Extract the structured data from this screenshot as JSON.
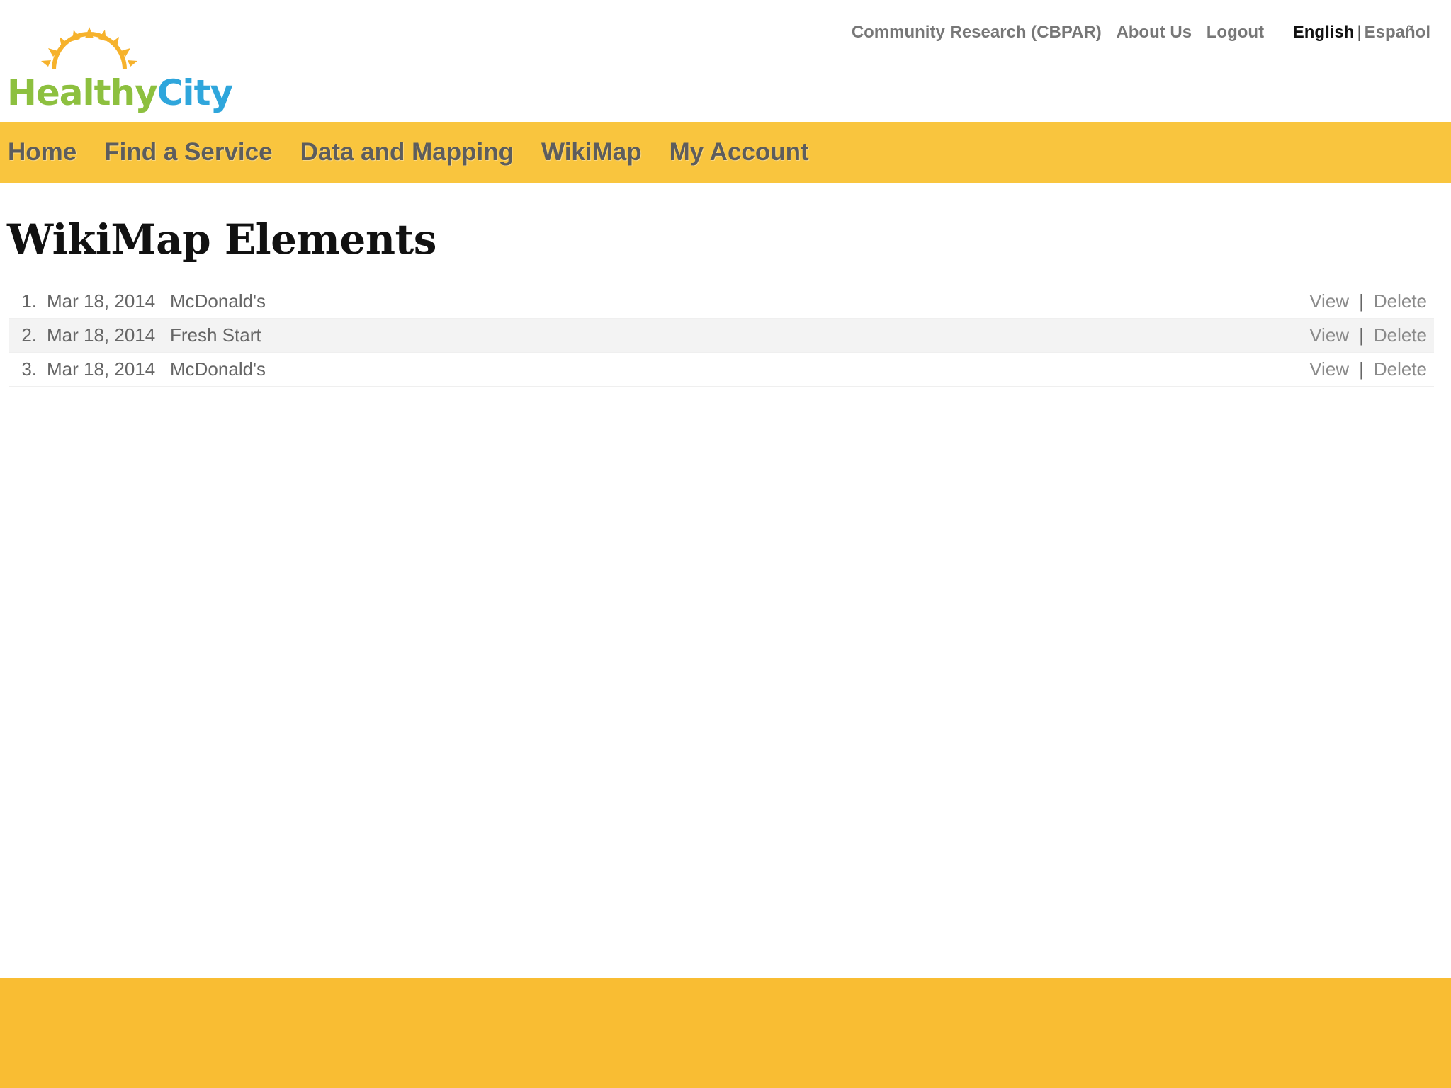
{
  "logo": {
    "part1": "Healthy",
    "part2": "City",
    "colors": {
      "healthy": "#8dc03f",
      "city": "#2fa6dc",
      "sun": "#f6b22c"
    }
  },
  "top_links": {
    "community": "Community Research (CBPAR)",
    "about": "About Us",
    "logout": "Logout",
    "lang_en": "English",
    "lang_sep": "|",
    "lang_es": "Español"
  },
  "nav": {
    "items": [
      {
        "label": "Home"
      },
      {
        "label": "Find a Service"
      },
      {
        "label": "Data and Mapping"
      },
      {
        "label": "WikiMap"
      },
      {
        "label": "My Account"
      }
    ]
  },
  "page": {
    "title": "WikiMap Elements"
  },
  "elements": {
    "rows": [
      {
        "num": "1.",
        "date": "Mar 18, 2014",
        "title": "McDonald's",
        "view": "View",
        "sep": "|",
        "delete": "Delete"
      },
      {
        "num": "2.",
        "date": "Mar 18, 2014",
        "title": "Fresh Start",
        "view": "View",
        "sep": "|",
        "delete": "Delete"
      },
      {
        "num": "3.",
        "date": "Mar 18, 2014",
        "title": "McDonald's",
        "view": "View",
        "sep": "|",
        "delete": "Delete"
      }
    ]
  },
  "colors": {
    "nav_bg": "#f9c53e",
    "footer_bg": "#f9bd33",
    "nav_text": "#5d5d5d"
  }
}
